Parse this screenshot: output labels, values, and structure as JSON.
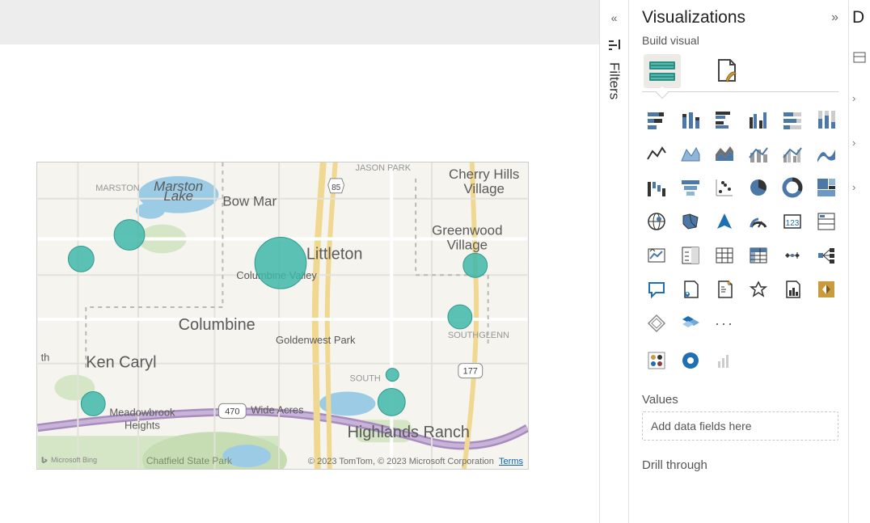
{
  "filters": {
    "label": "Filters"
  },
  "viz": {
    "title": "Visualizations",
    "build_label": "Build visual",
    "values_label": "Values",
    "values_placeholder": "Add data fields here",
    "drill_label": "Drill through",
    "ellipsis": "···"
  },
  "data_pane_letter": "D",
  "map": {
    "attribution_logo": "Microsoft Bing",
    "attribution_text": "© 2023 TomTom, © 2023 Microsoft Corporation",
    "terms": "Terms",
    "route_badge_1": "470",
    "route_badge_2": "177",
    "route_badge_3": "85",
    "labels": {
      "marston": "MARSTON",
      "marston_lake": "Marston\nLake",
      "bow_mar": "Bow Mar",
      "cherry_hills": "Cherry Hills\nVillage",
      "jason_park": "JASON PARK",
      "greenwood": "Greenwood\nVillage",
      "littleton": "Littleton",
      "columbine_valley": "Columbine Valley",
      "columbine": "Columbine",
      "goldenwest": "Goldenwest Park",
      "southglenn": "SOUTHGLENN",
      "south": "SOUTH",
      "ken_caryl": "Ken Caryl",
      "wide_acres": "Wide Acres",
      "meadowbrook": "Meadowbrook\nHeights",
      "highlands": "Highlands Ranch",
      "chatfield": "Chatfield State Park",
      "th": "th"
    }
  }
}
